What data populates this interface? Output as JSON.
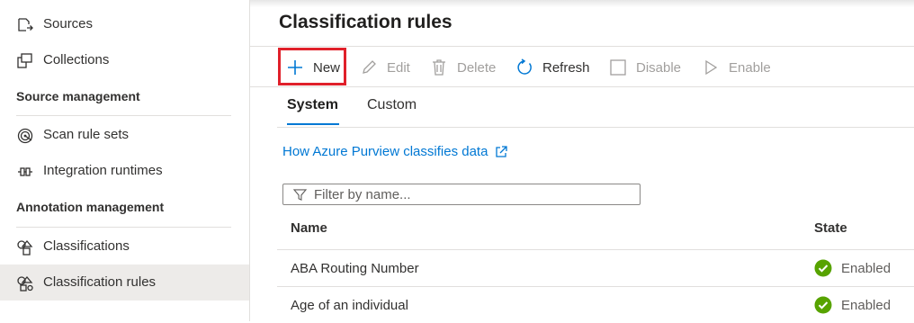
{
  "sidebar": {
    "items": [
      {
        "label": "Sources",
        "icon": "sources-icon"
      },
      {
        "label": "Collections",
        "icon": "collections-icon"
      },
      {
        "label": "Scan rule sets",
        "icon": "scan-rule-sets-icon"
      },
      {
        "label": "Integration runtimes",
        "icon": "integration-runtimes-icon"
      },
      {
        "label": "Classifications",
        "icon": "classifications-icon"
      },
      {
        "label": "Classification rules",
        "icon": "classification-rules-icon",
        "active": true
      }
    ],
    "headers": {
      "source_management": "Source management",
      "annotation_management": "Annotation management"
    }
  },
  "main": {
    "title": "Classification rules",
    "toolbar": {
      "new": "New",
      "edit": "Edit",
      "delete": "Delete",
      "refresh": "Refresh",
      "disable": "Disable",
      "enable": "Enable"
    },
    "tabs": [
      {
        "label": "System",
        "selected": true
      },
      {
        "label": "Custom",
        "selected": false
      }
    ],
    "help_link": "How Azure Purview classifies data",
    "filter": {
      "placeholder": "Filter by name..."
    },
    "table": {
      "columns": [
        "Name",
        "State"
      ],
      "rows": [
        {
          "name": "ABA Routing Number",
          "state": "Enabled"
        },
        {
          "name": "Age of an individual",
          "state": "Enabled"
        }
      ]
    }
  },
  "colors": {
    "accent": "#0078d4",
    "highlight": "#e0202a",
    "enabled_green": "#57a300",
    "disabled_text": "#a19f9d",
    "active_bg": "#edebe9"
  }
}
